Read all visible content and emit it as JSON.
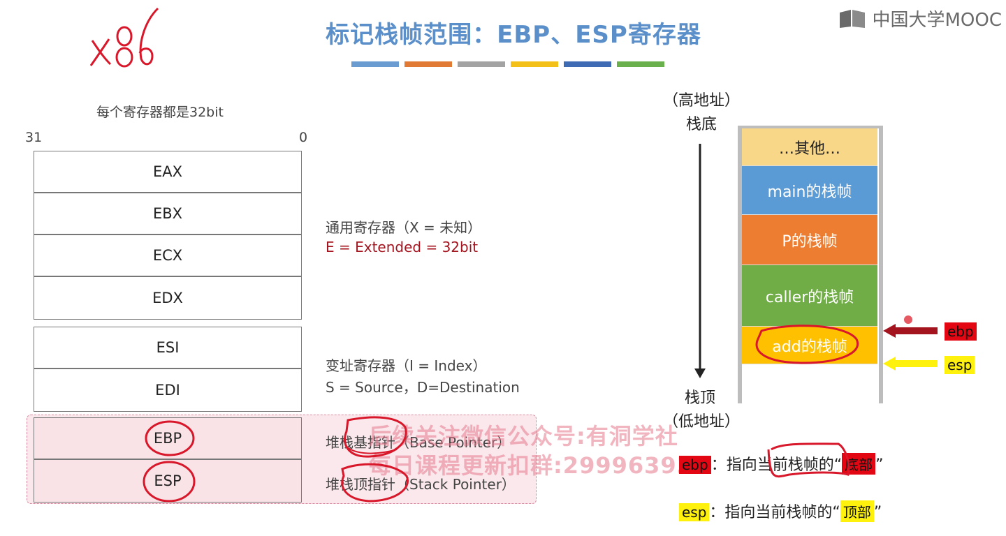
{
  "header": {
    "title": "标记栈帧范围：EBP、ESP寄存器",
    "logo_text": "中国大学MOOC",
    "handwritten_arch": "x86"
  },
  "color_bars": [
    "#6a9bd1",
    "#e07a34",
    "#a3a3a3",
    "#f2c018",
    "#3f6bb5",
    "#6ab04c"
  ],
  "registers": {
    "caption": "每个寄存器都是32bit",
    "bit_high": "31",
    "bit_low": "0",
    "items": [
      {
        "name": "EAX"
      },
      {
        "name": "EBX"
      },
      {
        "name": "ECX"
      },
      {
        "name": "EDX"
      },
      {
        "name": "ESI"
      },
      {
        "name": "EDI"
      },
      {
        "name": "EBP"
      },
      {
        "name": "ESP"
      }
    ]
  },
  "descriptions": {
    "general_line1": "通用寄存器（X = 未知）",
    "general_line2": "E = Extended = 32bit",
    "index_line1": "变址寄存器（I = Index）",
    "index_line2": "S = Source，D=Destination",
    "ebp_desc": "堆栈基指针（Base Pointer）",
    "esp_desc": "堆栈顶指针（Stack Pointer）"
  },
  "watermark": {
    "line1": "后续关注微信公众号:有洞学社",
    "line2": "每日课程更新扣群:299963939"
  },
  "stack": {
    "top_label_line1": "（高地址）",
    "top_label_line2": "栈底",
    "bottom_label_line1": "栈顶",
    "bottom_label_line2": "（低地址）",
    "frames": [
      {
        "label": "…其他…",
        "color": "#f9d788",
        "text_color": "#222"
      },
      {
        "label": "main的栈帧",
        "color": "#5b9bd5",
        "text_color": "#ffffff"
      },
      {
        "label": "P的栈帧",
        "color": "#ed7d31",
        "text_color": "#ffffff"
      },
      {
        "label": "caller的栈帧",
        "color": "#70ad47",
        "text_color": "#ffffff"
      },
      {
        "label": "add的栈帧",
        "color": "#ffc000",
        "text_color": "#ffffff"
      }
    ],
    "ebp_tag": "ebp",
    "esp_tag": "esp"
  },
  "notes": {
    "ebp_tag": "ebp",
    "ebp_text": "：指向当前栈帧的“",
    "ebp_highlight": "底部",
    "ebp_close": "”",
    "esp_tag": "esp",
    "esp_text": "：指向当前栈帧的“",
    "esp_highlight": "顶部",
    "esp_close": "”"
  }
}
